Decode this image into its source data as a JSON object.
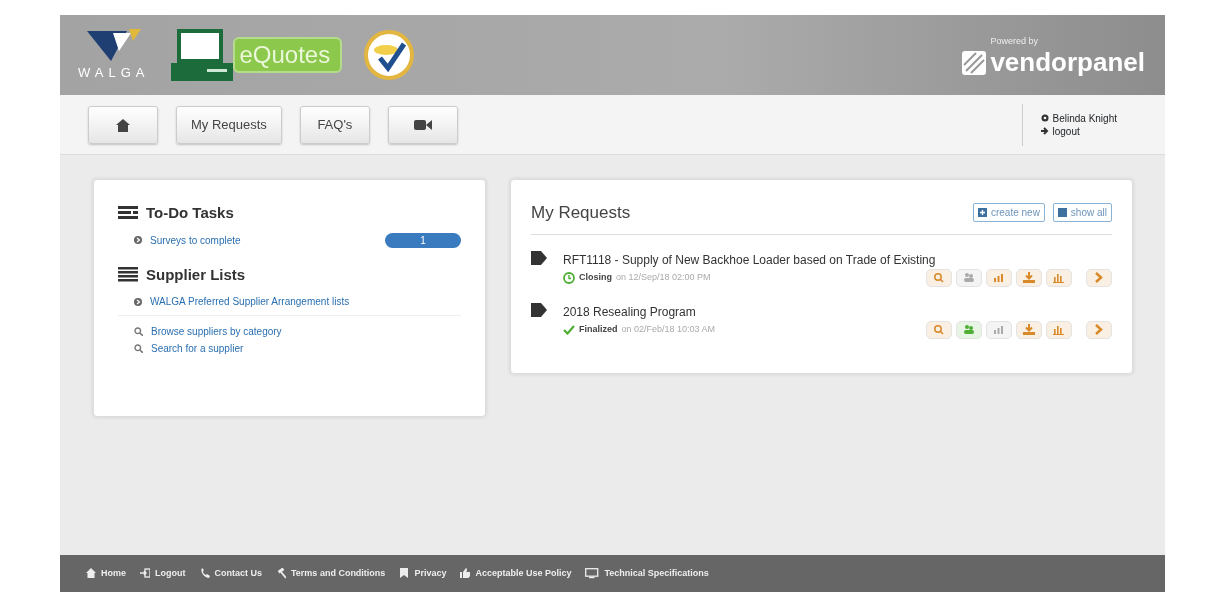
{
  "header": {
    "org_logo": "WALGA",
    "product_logo": "eQuotes",
    "powered_by": "Powered by",
    "vendor_logo": "vendorpanel"
  },
  "nav": {
    "buttons": [
      {
        "kind": "home"
      },
      {
        "kind": "text",
        "label": "My Requests"
      },
      {
        "kind": "text",
        "label": "FAQ's"
      },
      {
        "kind": "video"
      }
    ],
    "user": "Belinda Knight",
    "logout": "logout"
  },
  "todo": {
    "title": "To-Do Tasks",
    "items": [
      {
        "label": "Surveys to complete",
        "count": "1"
      }
    ]
  },
  "suppliers": {
    "title": "Supplier Lists",
    "items": [
      {
        "kind": "list",
        "label": "WALGA Preferred Supplier Arrangement lists"
      },
      {
        "kind": "search",
        "label": "Browse suppliers by category"
      },
      {
        "kind": "search",
        "label": "Search for a supplier"
      }
    ]
  },
  "requests": {
    "title": "My Requests",
    "buttons": [
      {
        "kind": "create",
        "label": "create new"
      },
      {
        "kind": "all",
        "label": "show all"
      }
    ],
    "items": [
      {
        "title": "RFT1118 - Supply of New Backhoe Loader based on Trade of Existing",
        "kind": "closing",
        "status": "Closing",
        "date": "on 12/Sep/18 02:00 PM",
        "actions": [
          {
            "kind": "search",
            "color": "#d8892a"
          },
          {
            "kind": "people",
            "color": "#aaaaaa"
          },
          {
            "kind": "chart",
            "color": "#d8892a"
          },
          {
            "kind": "download",
            "color": "#d8892a"
          },
          {
            "kind": "bars",
            "color": "#d8892a"
          },
          {
            "kind": "next",
            "color": "#d8892a"
          }
        ]
      },
      {
        "title": "2018 Resealing Program",
        "kind": "finalized",
        "status": "Finalized",
        "date": "on 02/Feb/18 10:03 AM",
        "actions": [
          {
            "kind": "search",
            "color": "#d8892a"
          },
          {
            "kind": "people",
            "color": "#4fae34"
          },
          {
            "kind": "chart",
            "color": "#aaaaaa"
          },
          {
            "kind": "download",
            "color": "#d8892a"
          },
          {
            "kind": "bars",
            "color": "#d8892a"
          },
          {
            "kind": "next",
            "color": "#d8892a"
          }
        ]
      }
    ]
  },
  "footer": [
    {
      "kind": "home",
      "label": "Home"
    },
    {
      "kind": "logout",
      "label": "Logout"
    },
    {
      "kind": "phone",
      "label": "Contact Us"
    },
    {
      "kind": "gavel",
      "label": "Terms and Conditions"
    },
    {
      "kind": "bookmark",
      "label": "Privacy"
    },
    {
      "kind": "thumb",
      "label": "Acceptable Use Policy"
    },
    {
      "kind": "monitor",
      "label": "Technical Specifications"
    }
  ]
}
